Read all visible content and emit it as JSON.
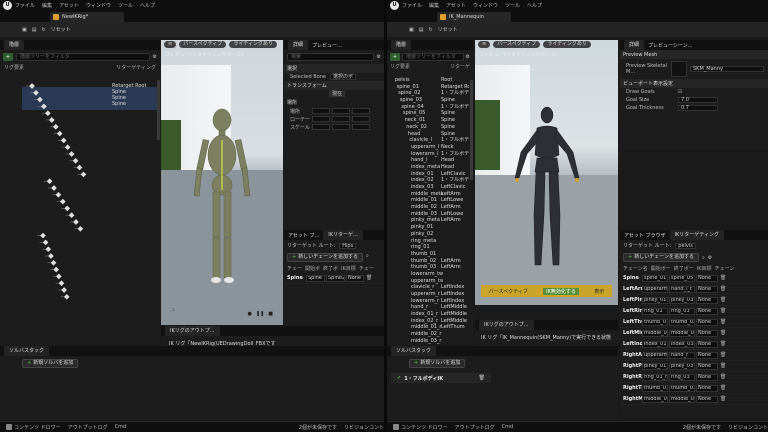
{
  "menu": [
    "ファイル",
    "編集",
    "アセット",
    "ウィンドウ",
    "ツール",
    "ヘルプ"
  ],
  "left": {
    "tab_title": "NewIKRig*",
    "toolbar": {
      "reset_label": "リセット"
    },
    "hierarchy": {
      "tab": "階層",
      "search_placeholder": "階層ツリーをフィルタ",
      "col_chain_element": "リグ要素",
      "col_retarget": "リターゲティング",
      "retarget_items": [
        "Retarget Root",
        "Spine",
        "Spine",
        "Spine"
      ]
    },
    "viewport": {
      "perspective": "パースペクティブ",
      "lighting": "ライティングあり",
      "caption": "プレビュー(リタゲティングポーズ)"
    },
    "details": {
      "tab": "詳細",
      "preview_tab": "プレビュー...",
      "search_placeholder": "検索",
      "selection": "選択",
      "selected_bone_label": "Selected Bone",
      "selected_bone_value": "選択のボ",
      "transform": "トランスフォーム",
      "current": "現在",
      "location": "場所",
      "rotation": "ローテー",
      "scale": "スケール"
    },
    "asset_tabs": {
      "asset": "アセット ブ...",
      "ikretarget": "IKリターゲ..."
    },
    "retarget": {
      "root_label": "リターゲット ルート:",
      "root_value": "Hips",
      "new_chain": "新しいチェーンを追加する",
      "headers": [
        "チェー",
        "開始ボ",
        "終了ボ",
        "IK目標",
        "チェー"
      ],
      "rows": [
        {
          "name": "Spine",
          "start": "Spine",
          "end": "Spine2",
          "goal": "None"
        }
      ]
    },
    "output": {
      "tab": "IKリグのアウトプ...",
      "line": "IK リグ「NewIKRig(UEDrawingDoll_FBXです"
    },
    "solver": {
      "tab": "ソルバスタック",
      "new_solver": "新規ソルバを追加"
    },
    "bottom": [
      "コンテンツ ドロワー",
      "アウトプットログ",
      "Cmd",
      "2個が未保存です",
      "リビジョンコント"
    ]
  },
  "right": {
    "tab_title": "IK_Mannequin",
    "toolbar": {
      "reset_label": "リセット"
    },
    "hierarchy": {
      "tab": "階層",
      "search_placeholder": "階層ツリーをフィルタ",
      "col_chain_element": "リグ要素",
      "col_retarget": "リターゲ",
      "bones": [
        "pelvis",
        "spine_01",
        "spine_02",
        "spine_03",
        "spine_04",
        "spine_05",
        "neck_01",
        "neck_02",
        "head",
        "clavicle_l",
        "upperarm_l",
        "lowerarm_l",
        "hand_l",
        "index_meta",
        "index_01",
        "index_02",
        "index_03",
        "middle_meta",
        "middle_01",
        "middle_02",
        "middle_03",
        "pinky_meta",
        "pinky_01",
        "pinky_02",
        "ring_meta",
        "ring_01",
        "thumb_01",
        "thumb_02",
        "thumb_03",
        "lowerarm_tw",
        "upperarm_tw",
        "clavicle_r",
        "upperarm_r",
        "lowerarm_r",
        "hand_r",
        "index_01_r",
        "index_02_r",
        "middle_01_r",
        "middle_02_r",
        "middle_03_r"
      ],
      "chains": [
        "Root",
        "Retarget Root",
        "1・フルボディ",
        "Spine",
        "1・フルボディ",
        "Spine",
        "Spine",
        "Spine",
        "Spine",
        "1・フルボディ",
        "Neck",
        "1・フルボディ",
        "Head",
        "Head",
        "LeftClavic",
        "1・フルボディ",
        "LeftClavic",
        "LeftArm",
        "LeftLowe",
        "LeftArm",
        "LeftLowe",
        "LeftArm",
        "",
        "",
        "",
        "",
        "",
        "LeftArm",
        "LeftArm",
        "",
        "",
        "LeftIndex",
        "LeftIndex",
        "LeftIndex",
        "LeftMiddle",
        "LeftMiddle",
        "LeftMiddle",
        "LeftThum"
      ]
    },
    "viewport": {
      "perspective": "パースペクティブ",
      "lighting": "ライティングあり",
      "caption": "プレビュー(リタゲティングポーズ)",
      "banner_left": "パースペクティブ",
      "banner_mid": "IK無効化する",
      "banner_right": "表示"
    },
    "details": {
      "tab": "詳細",
      "preview_tab": "プレビューシーン...",
      "preview_mesh": "Preview Mesh",
      "mesh_label": "Preview Skeletal M...",
      "mesh_value": "SKM_Manny",
      "settings": "ビューポート表示設定",
      "draw_goals": "Draw Goals",
      "goal_size": "Goal Size",
      "goal_size_value": "7.0",
      "goal_thickness": "Goal Thickness",
      "goal_thickness_value": "0.7"
    },
    "asset_tabs": {
      "asset": "アセット ブラウザ",
      "ikretarget": "IKリターゲティング"
    },
    "retarget": {
      "root_label": "リターゲット ルート:",
      "root_value": "pelvis",
      "new_chain": "新しいチェーンを追加する",
      "headers": [
        "チェーン名",
        "開始ボー",
        "終了ボー",
        "IK目標",
        "チェーン"
      ],
      "rows": [
        {
          "name": "Spine",
          "start": "spine_01",
          "end": "spine_05",
          "goal": "None"
        },
        {
          "name": "LeftArm",
          "start": "upperarm_l",
          "end": "hand_l_t",
          "goal": "None"
        },
        {
          "name": "LeftPinky",
          "start": "pinky_01",
          "end": "pinky_03",
          "goal": "None"
        },
        {
          "name": "LeftRing",
          "start": "ring_01",
          "end": "ring_03",
          "goal": "None"
        },
        {
          "name": "LeftThumb",
          "start": "thumb_01",
          "end": "thumb_03",
          "goal": "None"
        },
        {
          "name": "LeftMiddle",
          "start": "middle_01",
          "end": "middle_03",
          "goal": "None"
        },
        {
          "name": "LeftIndex",
          "start": "index_01",
          "end": "index_03",
          "goal": "None"
        },
        {
          "name": "RightArm",
          "start": "upperarm_r",
          "end": "hand_r",
          "goal": "None"
        },
        {
          "name": "RightPinky",
          "start": "pinky_01_r",
          "end": "pinky_03",
          "goal": "None"
        },
        {
          "name": "RightRing",
          "start": "ring_01_r",
          "end": "ring_03",
          "goal": "None"
        },
        {
          "name": "RightThumb",
          "start": "thumb_01",
          "end": "thumb_03",
          "goal": "None"
        },
        {
          "name": "RightMiddle",
          "start": "middle_01",
          "end": "middle_03",
          "goal": "None"
        }
      ]
    },
    "output": {
      "tab": "IKリグのアウトプ...",
      "line": "IK リグ「IK_Mannequin(SKM_Manny)で実行できる状態"
    },
    "solver": {
      "tab": "ソルバスタック",
      "new_solver": "新規ソルバを追加",
      "item": "1・フルボディIK"
    },
    "bottom": [
      "コンテンツ ドロワー",
      "アウトプットログ",
      "Cmd",
      "2個が未保存です",
      "リビジョンコント"
    ]
  }
}
